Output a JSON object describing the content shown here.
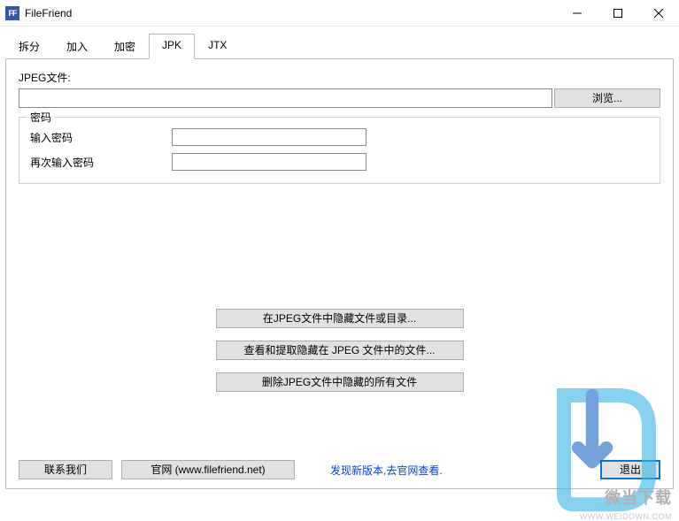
{
  "window": {
    "title": "FileFriend",
    "icon_text": "FF"
  },
  "tabs": [
    {
      "label": "拆分"
    },
    {
      "label": "加入"
    },
    {
      "label": "加密"
    },
    {
      "label": "JPK"
    },
    {
      "label": "JTX"
    }
  ],
  "active_tab_index": 3,
  "jpk_page": {
    "file_label": "JPEG文件:",
    "file_value": "",
    "browse_label": "浏览...",
    "password_group": {
      "title": "密码",
      "enter_label": "输入密码",
      "enter_value": "",
      "confirm_label": "再次输入密码",
      "confirm_value": ""
    },
    "hide_button": "在JPEG文件中隐藏文件或目录...",
    "extract_button": "查看和提取隐藏在 JPEG 文件中的文件...",
    "delete_button": "删除JPEG文件中隐藏的所有文件"
  },
  "footer": {
    "contact_label": "联系我们",
    "website_label": "官网 (www.filefriend.net)",
    "update_link": "发现新版本,去官网查看.",
    "exit_label": "退出"
  },
  "watermark": {
    "brand": "微当下载",
    "url": "WWW.WEIDOWN.COM"
  }
}
